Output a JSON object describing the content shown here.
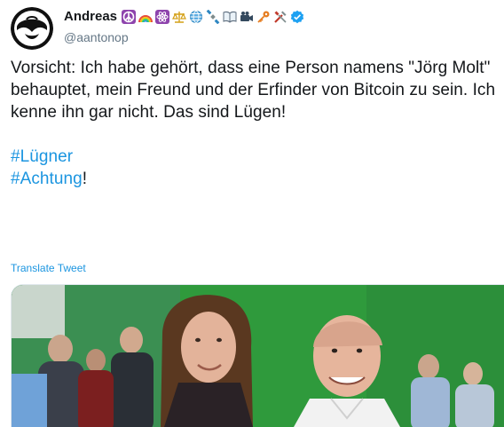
{
  "author": {
    "name": "Andreas",
    "handle": "@aantonop",
    "name_emojis": [
      "peace-icon",
      "rainbow-icon",
      "atom-icon",
      "scales-icon",
      "globe-icon",
      "satellite-icon",
      "book-icon",
      "film-camera-icon",
      "key-icon",
      "tools-icon"
    ],
    "verified": true
  },
  "tweet": {
    "paragraphs": [
      "Vorsicht: Ich habe gehört, dass eine Person namens \"Jörg Molt\" behauptet, mein Freund und der Erfinder von Bitcoin zu sein. Ich kenne ihn gar nicht. Das sind Lügen!"
    ],
    "hashtag_1": "#Lügner",
    "hashtag_2": "#Achtung",
    "hashtag_2_suffix": "!"
  },
  "translate_label": "Translate Tweet",
  "colors": {
    "link": "#1b95e0",
    "text": "#14171a",
    "handle": "#657786",
    "verified": "#1da1f2"
  }
}
